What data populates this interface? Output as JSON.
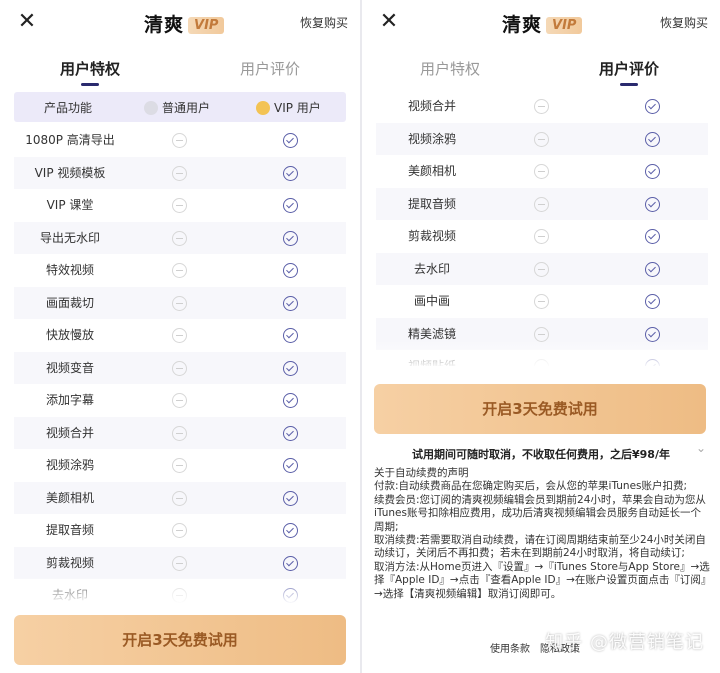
{
  "brand": {
    "name": "清爽",
    "vip": "VIP"
  },
  "restore_label": "恢复购买",
  "tabs": [
    "用户特权",
    "用户评价"
  ],
  "table_header": {
    "feature": "产品功能",
    "normal": "普通用户",
    "vip": "VIP 用户"
  },
  "left_rows": [
    {
      "name": "1080P 高清导出"
    },
    {
      "name": "VIP 视频模板"
    },
    {
      "name": "VIP 课堂"
    },
    {
      "name": "导出无水印"
    },
    {
      "name": "特效视频"
    },
    {
      "name": "画面裁切"
    },
    {
      "name": "快放慢放"
    },
    {
      "name": "视频变音"
    },
    {
      "name": "添加字幕"
    },
    {
      "name": "视频合并"
    },
    {
      "name": "视频涂鸦"
    },
    {
      "name": "美颜相机"
    },
    {
      "name": "提取音频"
    },
    {
      "name": "剪裁视频"
    },
    {
      "name": "去水印"
    }
  ],
  "right_rows": [
    {
      "name": "视频合并"
    },
    {
      "name": "视频涂鸦"
    },
    {
      "name": "美颜相机"
    },
    {
      "name": "提取音频"
    },
    {
      "name": "剪裁视频"
    },
    {
      "name": "去水印"
    },
    {
      "name": "画中画"
    },
    {
      "name": "精美滤镜"
    },
    {
      "name": "视频贴纸"
    }
  ],
  "cta_label": "开启3天免费试用",
  "trial_notice": "试用期间可随时取消，不收取任何费用，之后¥98/年",
  "legal_lines": [
    "关于自动续费的声明",
    "付款:自动续费商品在您确定购买后，会从您的苹果iTunes账户扣费;",
    "续费会员:您订阅的清爽视频编辑会员到期前24小时，苹果会自动为您从iTunes账号扣除相应费用，成功后清爽视频编辑会员服务自动延长一个周期;",
    "取消续费:若需要取消自动续费，请在订阅周期结束前至少24小时关闭自动续订，关闭后不再扣费；若未在到期前24小时取消，将自动续订;",
    "取消方法:从Home页进入『设置』→『iTunes Store与App Store』→选择『Apple ID』→点击『查看Apple ID』→在账户设置页面点击『订阅』→选择【清爽视频编辑】取消订阅即可。"
  ],
  "footer": {
    "terms": "使用条款",
    "privacy": "隐私政策"
  },
  "watermark": "知乎 @微营销笔记"
}
